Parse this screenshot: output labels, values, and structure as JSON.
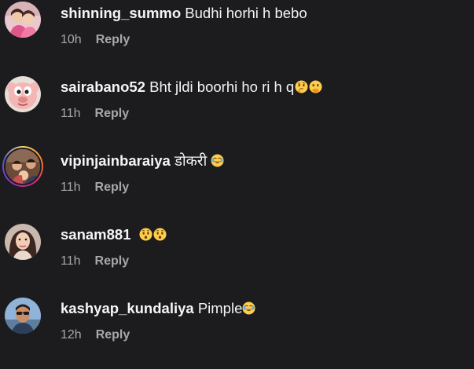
{
  "comments": [
    {
      "username": "shinning_summo",
      "text": "Budhi horhi h bebo",
      "emojis": [],
      "time": "10h",
      "reply_label": "Reply",
      "avatar_icon": "avatar-girl-pink-photo",
      "story_ring": false
    },
    {
      "username": "sairabano52",
      "text": "Bht jldi boorhi ho ri h q",
      "emojis": [
        "thinking-face-emoji",
        "face-with-hand-over-mouth-emoji"
      ],
      "time": "11h",
      "reply_label": "Reply",
      "avatar_icon": "avatar-cartoon-face",
      "story_ring": false
    },
    {
      "username": "vipinjainbaraiya",
      "text": "डोकरी",
      "emojis": [
        "laughing-tears-emoji"
      ],
      "time": "11h",
      "reply_label": "Reply",
      "avatar_icon": "avatar-group-photo",
      "story_ring": true
    },
    {
      "username": "sanam881",
      "text": "",
      "emojis": [
        "hushed-face-emoji",
        "hushed-face-emoji"
      ],
      "time": "11h",
      "reply_label": "Reply",
      "avatar_icon": "avatar-woman-photo",
      "story_ring": false
    },
    {
      "username": "kashyap_kundaliya",
      "text": "Pimple",
      "emojis": [
        "laughing-tears-emoji"
      ],
      "time": "12h",
      "reply_label": "Reply",
      "avatar_icon": "avatar-man-sunglasses-photo",
      "story_ring": false
    }
  ],
  "colors": {
    "background": "#1c1c1e",
    "primary_text": "#f5f5f5",
    "secondary_text": "#a8a8a8"
  }
}
